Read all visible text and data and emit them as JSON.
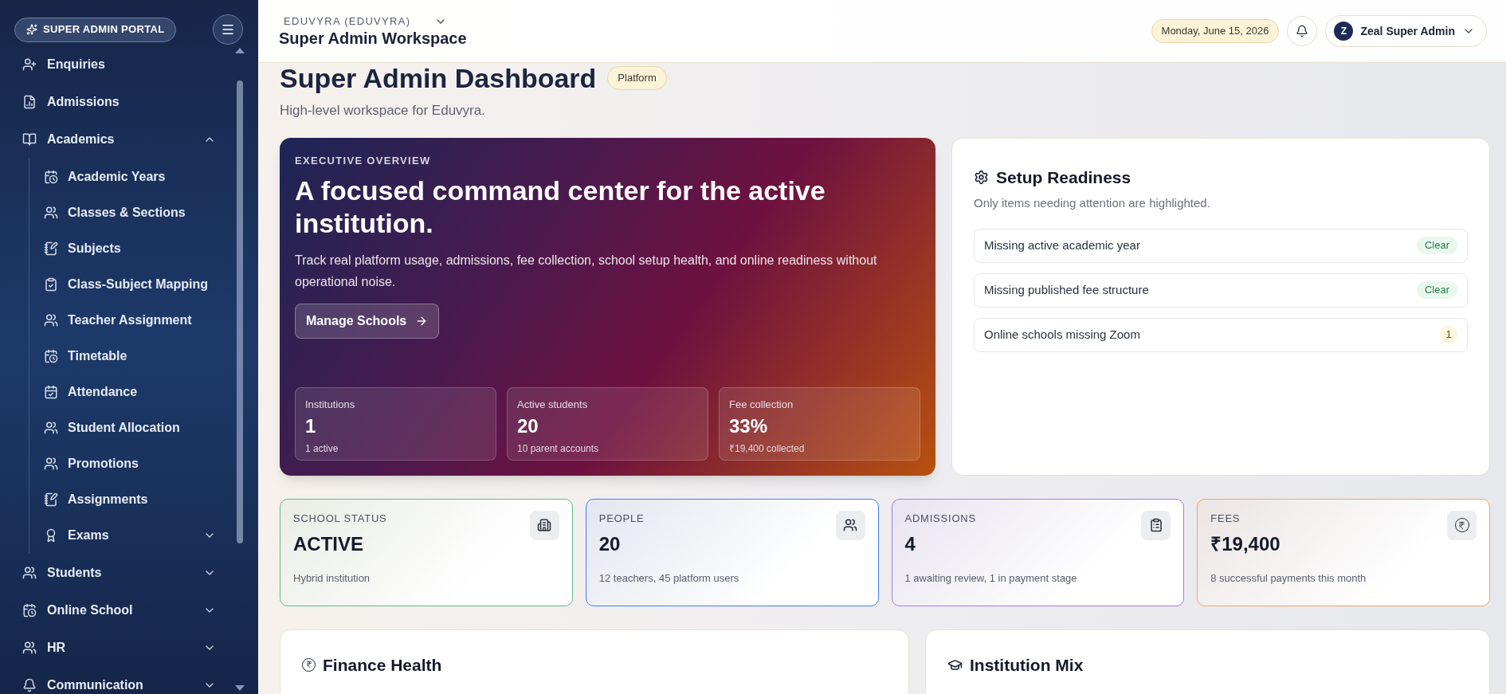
{
  "sidebar": {
    "portal_badge": "SUPER ADMIN PORTAL",
    "items": [
      {
        "label": "Enquiries"
      },
      {
        "label": "Admissions"
      },
      {
        "label": "Academics",
        "expanded": true,
        "children": [
          {
            "label": "Academic Years"
          },
          {
            "label": "Classes & Sections"
          },
          {
            "label": "Subjects"
          },
          {
            "label": "Class-Subject Mapping"
          },
          {
            "label": "Teacher Assignment"
          },
          {
            "label": "Timetable"
          },
          {
            "label": "Attendance"
          },
          {
            "label": "Student Allocation"
          },
          {
            "label": "Promotions"
          },
          {
            "label": "Assignments"
          },
          {
            "label": "Exams",
            "expanded": false
          }
        ]
      },
      {
        "label": "Students",
        "expanded": false
      },
      {
        "label": "Online School",
        "expanded": false
      },
      {
        "label": "HR",
        "expanded": false
      },
      {
        "label": "Communication",
        "expanded": false
      }
    ]
  },
  "header": {
    "organization": "EDUVYRA (EDUVYRA)",
    "workspace": "Super Admin Workspace",
    "date": "Monday, June 15, 2026",
    "user": {
      "initial": "Z",
      "name": "Zeal Super Admin"
    }
  },
  "page": {
    "title": "Super Admin Dashboard",
    "badge": "Platform",
    "subtitle": "High-level workspace for Eduvyra."
  },
  "overview": {
    "eyebrow": "EXECUTIVE OVERVIEW",
    "heading": "A focused command center for the active institution.",
    "description": "Track real platform usage, admissions, fee collection, school setup health, and online readiness without operational noise.",
    "button": "Manage Schools",
    "metrics": [
      {
        "label": "Institutions",
        "value": "1",
        "note": "1 active"
      },
      {
        "label": "Active students",
        "value": "20",
        "note": "10 parent accounts"
      },
      {
        "label": "Fee collection",
        "value": "33%",
        "note": "₹19,400 collected"
      }
    ]
  },
  "setup_readiness": {
    "title": "Setup Readiness",
    "subtitle": "Only items needing attention are highlighted.",
    "items": [
      {
        "label": "Missing active academic year",
        "status": "Clear",
        "kind": "ok"
      },
      {
        "label": "Missing published fee structure",
        "status": "Clear",
        "kind": "ok"
      },
      {
        "label": "Online schools missing Zoom",
        "status": "1",
        "kind": "attention"
      }
    ]
  },
  "stat_cards": [
    {
      "label": "SCHOOL STATUS",
      "value": "ACTIVE",
      "note": "Hybrid institution",
      "color": "#5fb98a"
    },
    {
      "label": "PEOPLE",
      "value": "20",
      "note": "12 teachers, 45 platform users",
      "color": "#3b82f6"
    },
    {
      "label": "ADMISSIONS",
      "value": "4",
      "note": "1 awaiting review, 1 in payment stage",
      "color": "#a27be8"
    },
    {
      "label": "FEES",
      "value": "₹19,400",
      "note": "8 successful payments this month",
      "color": "#f0a46a"
    }
  ],
  "panels": [
    {
      "title": "Finance Health"
    },
    {
      "title": "Institution Mix"
    }
  ]
}
